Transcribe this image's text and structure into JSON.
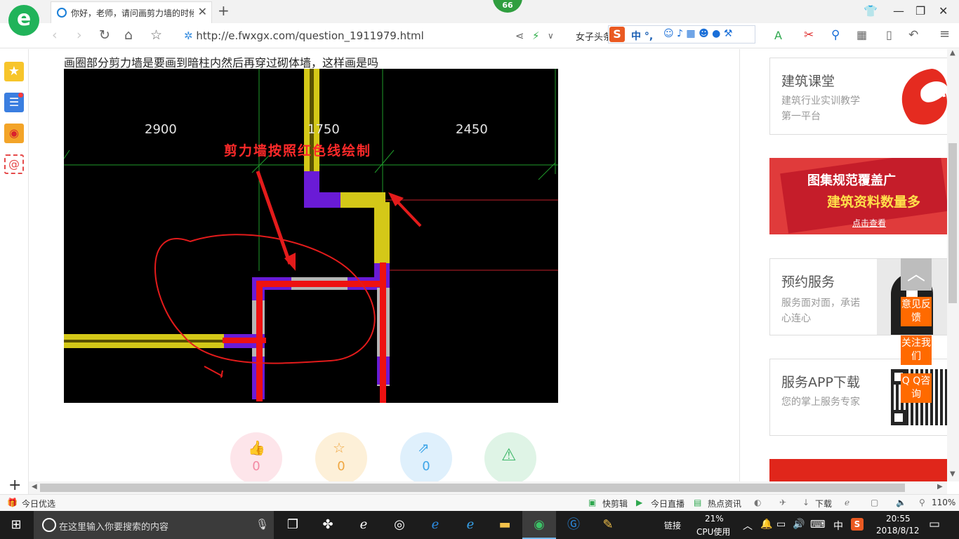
{
  "browser": {
    "tab_title": "你好，老师，请问画剪力墙的时候",
    "new_tab": "+",
    "badge_count": "66",
    "url": "http://e.fwxgx.com/question_1911979.html",
    "search_suggestion": "女子头条",
    "ime": {
      "logo": "S",
      "mode": "中 °,"
    }
  },
  "page": {
    "question_text": "画圈部分剪力墙是要画到暗柱内然后再穿过砌体墙，这样画是吗",
    "drawing": {
      "dims": [
        "2900",
        "1750",
        "2450"
      ],
      "annotation": "剪力墙按照红色线绘制"
    },
    "actions": {
      "like": {
        "count": "0",
        "color": "#f38aa4",
        "bg": "#fde5ea"
      },
      "favorite": {
        "count": "0",
        "color": "#f0a742",
        "bg": "#fdf0d8"
      },
      "share": {
        "count": "0",
        "color": "#3fa6e8",
        "bg": "#dff0fc"
      },
      "report": {
        "count": "",
        "color": "#3fb76a",
        "bg": "#dff4e6"
      }
    }
  },
  "sidebar": {
    "cards": [
      {
        "title": "建筑课堂",
        "desc": "建筑行业实训教学第一平台"
      },
      {
        "banner_line1": "图集规范覆盖广",
        "banner_line2": "建筑资料数量多",
        "banner_btn": "点击查看"
      },
      {
        "title": "预约服务",
        "desc": "服务面对面，承诺心连心"
      },
      {
        "title": "服务APP下载",
        "desc": "您的掌上服务专家"
      }
    ],
    "float_buttons": [
      "意见反馈",
      "关注我们",
      "Q Q咨询"
    ]
  },
  "statusbar": {
    "left": "今日优选",
    "items": [
      "快剪辑",
      "今日直播",
      "热点资讯",
      "下载"
    ],
    "zoom": "110%"
  },
  "taskbar": {
    "search_placeholder": "在这里输入你要搜索的内容",
    "link_label": "链接",
    "cpu_percent": "21%",
    "cpu_label": "CPU使用",
    "ime": "中",
    "time": "20:55",
    "date": "2018/8/12"
  }
}
